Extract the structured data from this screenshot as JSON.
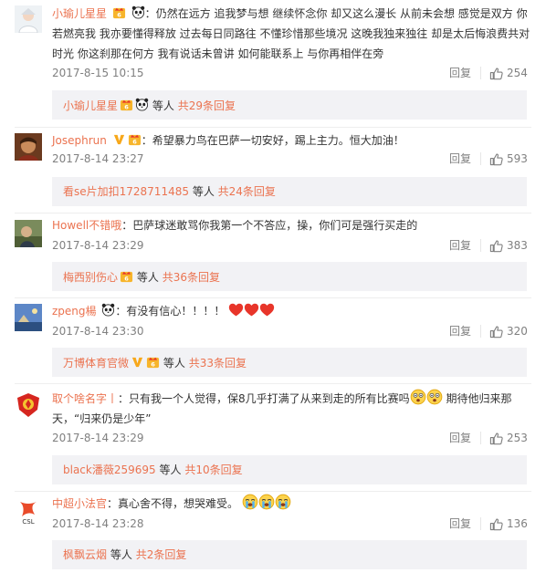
{
  "comments": [
    {
      "user": "小瑜儿星星",
      "separator": "：",
      "text": "仍然在远方 追我梦与想 继续怀念你 却又这么漫长 从前未会想 感觉是双方 你若燃亮我 我亦要懂得释放 过去每日同路往 不懂珍惜那些境况 这晚我独来独往 却是太后悔浪费共对时光 你这刹那在何方 我有说话未曾讲 如何能联系上 与你再相伴在旁",
      "time": "2017-8-15 10:15",
      "reply_label": "回复",
      "likes": "254",
      "sub": {
        "first_user": "小瑜儿星星",
        "others": "等人",
        "count": "共29条回复"
      }
    },
    {
      "user": "Josephrun",
      "separator": "：",
      "text": "希望暴力鸟在巴萨一切安好，踢上主力。恒大加油！",
      "time": "2017-8-14 23:27",
      "reply_label": "回复",
      "likes": "593",
      "sub": {
        "first_user": "看se片加扣1728711485",
        "others": "等人",
        "count": "共24条回复"
      }
    },
    {
      "user": "Howell不错哦",
      "separator": "：",
      "text": "巴萨球迷敢骂你我第一个不答应，操，你们可是强行买走的",
      "time": "2017-8-14 23:29",
      "reply_label": "回复",
      "likes": "383",
      "sub": {
        "first_user": "梅西别伤心",
        "others": "等人",
        "count": "共36条回复"
      }
    },
    {
      "user": "zpeng楊",
      "separator": "：",
      "text": "有没有信心！！！！",
      "time": "2017-8-14 23:30",
      "reply_label": "回复",
      "likes": "320",
      "sub": {
        "first_user": "万博体育官微",
        "others": "等人",
        "count": "共33条回复"
      }
    },
    {
      "user": "取个啥名字丨",
      "separator": "：",
      "text_a": "只有我一个人觉得，保8几乎打满了从来到走的所有比赛吗",
      "text_b": " 期待他归来那天，“归来仍是少年”",
      "time": "2017-8-14 23:29",
      "reply_label": "回复",
      "likes": "253",
      "sub": {
        "first_user": "black潘薇259695",
        "others": "等人",
        "count": "共10条回复"
      }
    },
    {
      "user": "中超小法官",
      "separator": "：",
      "text": "真心舍不得，想哭难受。",
      "time": "2017-8-14 23:28",
      "reply_label": "回复",
      "likes": "136",
      "sub": {
        "first_user": "枫飘云烟",
        "others": "等人",
        "count": "共2条回复"
      }
    }
  ],
  "colors": {
    "username": "#eb7350",
    "meta": "#808080",
    "text": "#333333",
    "sub_bg": "#f2f2f5",
    "heart": "#e8352a"
  },
  "icons": [
    "panda-emoji",
    "vip-badge-icon",
    "verified-v-icon",
    "thumb-up-icon",
    "heart-emoji",
    "shock-emoji",
    "cry-emoji"
  ]
}
